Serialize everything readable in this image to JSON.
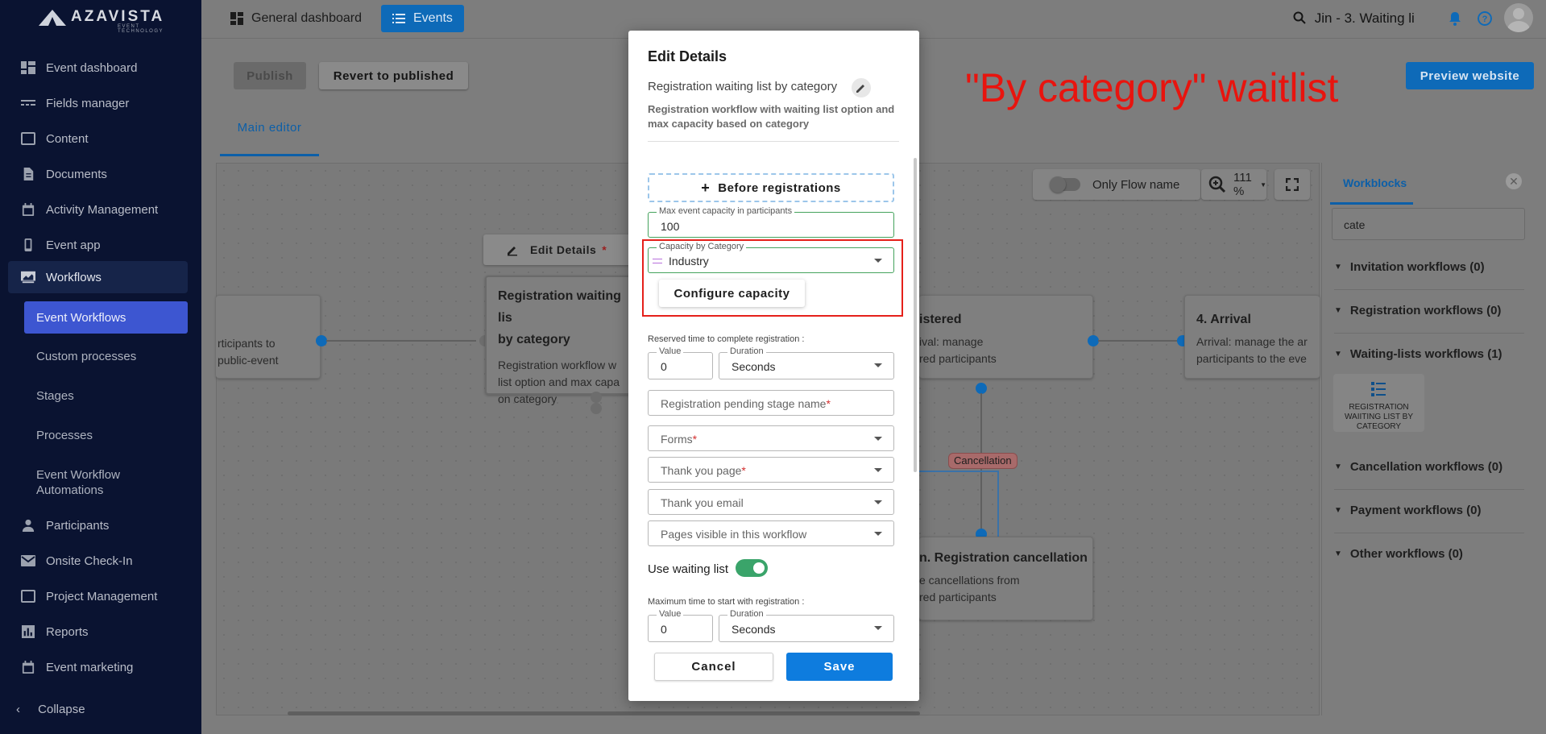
{
  "brand": {
    "name": "AZAVISTA",
    "tagline": "EVENT TECHNOLOGY"
  },
  "sidebar": {
    "items": [
      {
        "label": "Event dashboard",
        "icon": "dashboard-icon"
      },
      {
        "label": "Fields manager",
        "icon": "fields-icon"
      },
      {
        "label": "Content",
        "icon": "content-icon"
      },
      {
        "label": "Documents",
        "icon": "document-icon"
      },
      {
        "label": "Activity Management",
        "icon": "calendar-icon"
      },
      {
        "label": "Event app",
        "icon": "phone-icon"
      },
      {
        "label": "Workflows",
        "icon": "workflow-icon"
      },
      {
        "label": "Participants",
        "icon": "person-icon"
      },
      {
        "label": "Onsite Check-In",
        "icon": "mail-icon"
      },
      {
        "label": "Project Management",
        "icon": "project-icon"
      },
      {
        "label": "Reports",
        "icon": "chart-icon"
      },
      {
        "label": "Event marketing",
        "icon": "calendar-icon"
      }
    ],
    "subitems": [
      {
        "label": "Event Workflows"
      },
      {
        "label": "Custom processes"
      },
      {
        "label": "Stages"
      },
      {
        "label": "Processes"
      },
      {
        "label": "Event Workflow Automations"
      }
    ],
    "collapse_label": "Collapse"
  },
  "topbar": {
    "general_dashboard": "General dashboard",
    "events": "Events",
    "search_text": "Jin - 3. Waiting li"
  },
  "header": {
    "publish": "Publish",
    "revert": "Revert to published",
    "preview": "Preview website",
    "main_tab": "Main editor"
  },
  "annotation": "\"By category\" waitlist",
  "canvas": {
    "left_card_line1": "rticipants to",
    "left_card_line2": "public-event",
    "edit_details_tab": "Edit Details",
    "edit_details_star": "*",
    "center_card_title_l1": "Registration waiting lis",
    "center_card_title_l2": "by category",
    "center_card_desc_l1": "Registration workflow w",
    "center_card_desc_l2": "list option and max capa",
    "center_card_desc_l3": "on category",
    "registered_title": "istered",
    "registered_desc_l1": "ival: manage",
    "registered_desc_l2": "red participants",
    "arrival_title": "4. Arrival",
    "arrival_desc_l1": "Arrival: manage the ar",
    "arrival_desc_l2": "participants to the eve",
    "cancellation_badge": "Cancellation",
    "reg_cancel_title": "n. Registration cancellation",
    "reg_cancel_desc_l1": "e cancellations from",
    "reg_cancel_desc_l2": "red participants",
    "only_flow_name": "Only Flow name",
    "zoom_level": "111 %"
  },
  "right_panel": {
    "tab": "Workblocks",
    "search_value": "cate",
    "categories": [
      "Invitation workflows (0)",
      "Registration workflows (0)",
      "Waiting-lists workflows (1)",
      "Cancellation workflows (0)",
      "Payment workflows (0)",
      "Other workflows (0)"
    ],
    "block_label": "REGISTRATION WAIITING LIST BY CATEGORY"
  },
  "modal": {
    "title": "Edit Details",
    "workflow_name": "Registration waiting list by category",
    "description": "Registration workflow with waiting list option and max capacity based on category",
    "before_registrations": "Before registrations",
    "max_capacity_label": "Max event capacity in participants",
    "max_capacity_value": "100",
    "capacity_by_category_label": "Capacity by Category",
    "capacity_by_category_value": "Industry",
    "configure_capacity": "Configure capacity",
    "reserved_time_label": "Reserved time to complete registration :",
    "value_label": "Value",
    "value1": "0",
    "duration_label": "Duration",
    "duration1": "Seconds",
    "pending_stage_placeholder": "Registration pending stage name",
    "forms_placeholder": "Forms",
    "thank_you_page_placeholder": "Thank you page",
    "thank_you_email_placeholder": "Thank you email",
    "pages_visible_placeholder": "Pages visible in this workflow",
    "required_mark": "*",
    "use_waiting_list": "Use waiting list",
    "max_time_label": "Maximum time to start with registration :",
    "value2": "0",
    "duration2": "Seconds",
    "cancel": "Cancel",
    "save": "Save"
  },
  "colors": {
    "primary": "#0e7cde",
    "sidebar_bg": "#0a1331",
    "sidebar_selected": "#3d56d1",
    "annotation_red": "#e8140e",
    "valid_green": "#45a35d"
  }
}
